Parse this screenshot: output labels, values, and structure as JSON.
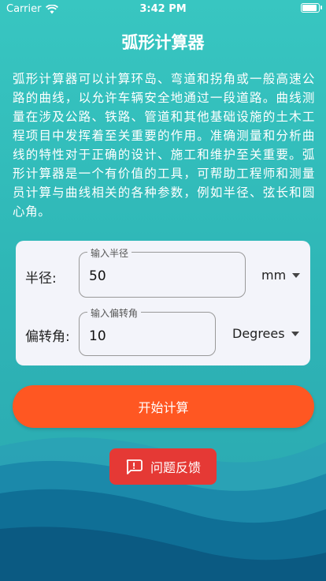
{
  "status_bar": {
    "carrier": "Carrier",
    "time": "3:42 PM"
  },
  "header": {
    "title": "弧形计算器"
  },
  "description": "弧形计算器可以计算环岛、弯道和拐角或一般高速公路的曲线，以允许车辆安全地通过一段道路。曲线测量在涉及公路、铁路、管道和其他基础设施的土木工程项目中发挥着至关重要的作用。准确测量和分析曲线的特性对于正确的设计、施工和维护至关重要。弧形计算器是一个有价值的工具，可帮助工程师和测量员计算与曲线相关的各种参数，例如半径、弦长和圆心角。",
  "form": {
    "radius": {
      "label": "半径:",
      "field_label": "输入半径",
      "value": "50",
      "unit": "mm"
    },
    "angle": {
      "label": "偏转角:",
      "field_label": "输入偏转角",
      "value": "10",
      "unit": "Degrees"
    }
  },
  "actions": {
    "calculate": "开始计算",
    "feedback": "问题反馈"
  },
  "colors": {
    "primary_button": "#ff5722",
    "feedback_button": "#e53935",
    "background_top": "#38c6c1",
    "wave_dark": "#0d5f88"
  },
  "icons": {
    "wifi": "wifi-icon",
    "battery": "battery-icon",
    "feedback": "feedback-icon",
    "dropdown": "chevron-down-icon"
  }
}
